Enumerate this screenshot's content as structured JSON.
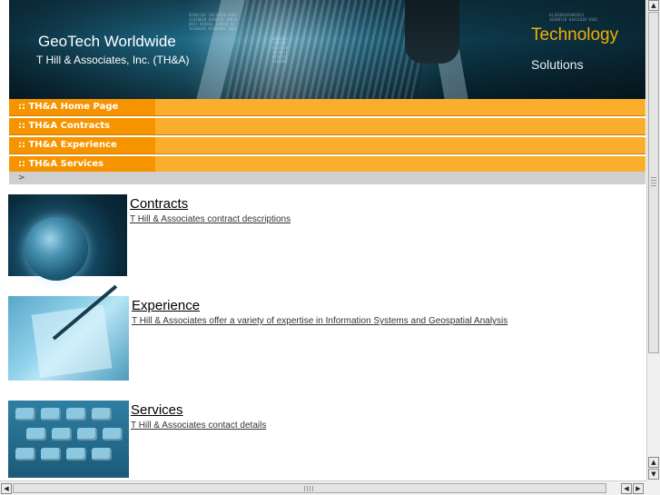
{
  "header": {
    "title": "GeoTech Worldwide",
    "subtitle": "T Hill & Associates, Inc. (TH&A)",
    "tagline_top": "Technology",
    "tagline_bottom": "Solutions"
  },
  "nav": {
    "items": [
      {
        "label": ":: TH&A Home Page"
      },
      {
        "label": ":: TH&A Contracts"
      },
      {
        "label": ":: TH&A Experience"
      },
      {
        "label": ":: TH&A Services"
      }
    ]
  },
  "breadcrumb": ">",
  "sections": [
    {
      "title": "Contracts",
      "description": "T Hill & Associates contract descriptions",
      "image_icon": "globe-image"
    },
    {
      "title": "Experience",
      "description": "T Hill & Associates offer a variety of expertise in Information Systems and Geospatial Analysis",
      "image_icon": "pen-paper-image"
    },
    {
      "title": "Services",
      "description": "T Hill & Associates contact details",
      "image_icon": "keyboard-image"
    }
  ],
  "colors": {
    "nav_bar": "#fbad2c",
    "nav_tab": "#f69400",
    "tagline": "#f2b000",
    "banner": "#1f6a86"
  },
  "icons": {
    "scroll_up": "▲",
    "scroll_down": "▼",
    "scroll_left": "◀",
    "scroll_right": "▶"
  }
}
